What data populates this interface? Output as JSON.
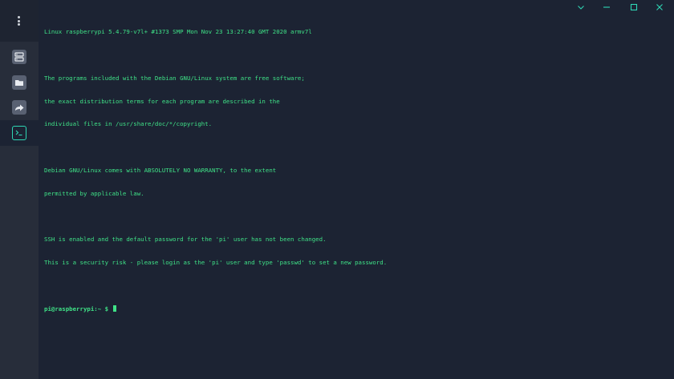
{
  "window": {
    "controls": [
      {
        "name": "minimize",
        "icon": "minimize-icon"
      },
      {
        "name": "maximize",
        "icon": "maximize-icon"
      },
      {
        "name": "close",
        "icon": "close-icon"
      }
    ],
    "control_color": "#2fd6b4"
  },
  "sidebar": {
    "menu_icon": "more-vertical-icon",
    "items": [
      {
        "name": "hosts",
        "icon": "server-icon"
      },
      {
        "name": "files",
        "icon": "folder-icon"
      },
      {
        "name": "port-forwarding",
        "icon": "forward-icon"
      },
      {
        "name": "terminal",
        "icon": "terminal-icon",
        "active": true
      }
    ],
    "active_color": "#2fd6b4"
  },
  "terminal": {
    "text_color": "#3fe287",
    "lines": [
      "Linux raspberrypi 5.4.79-v7l+ #1373 SMP Mon Nov 23 13:27:40 GMT 2020 armv7l",
      "",
      "The programs included with the Debian GNU/Linux system are free software;",
      "the exact distribution terms for each program are described in the",
      "individual files in /usr/share/doc/*/copyright.",
      "",
      "Debian GNU/Linux comes with ABSOLUTELY NO WARRANTY, to the extent",
      "permitted by applicable law.",
      "",
      "SSH is enabled and the default password for the 'pi' user has not been changed.",
      "This is a security risk - please login as the 'pi' user and type 'passwd' to set a new password.",
      ""
    ],
    "prompt": "pi@raspberrypi:~ $ "
  }
}
